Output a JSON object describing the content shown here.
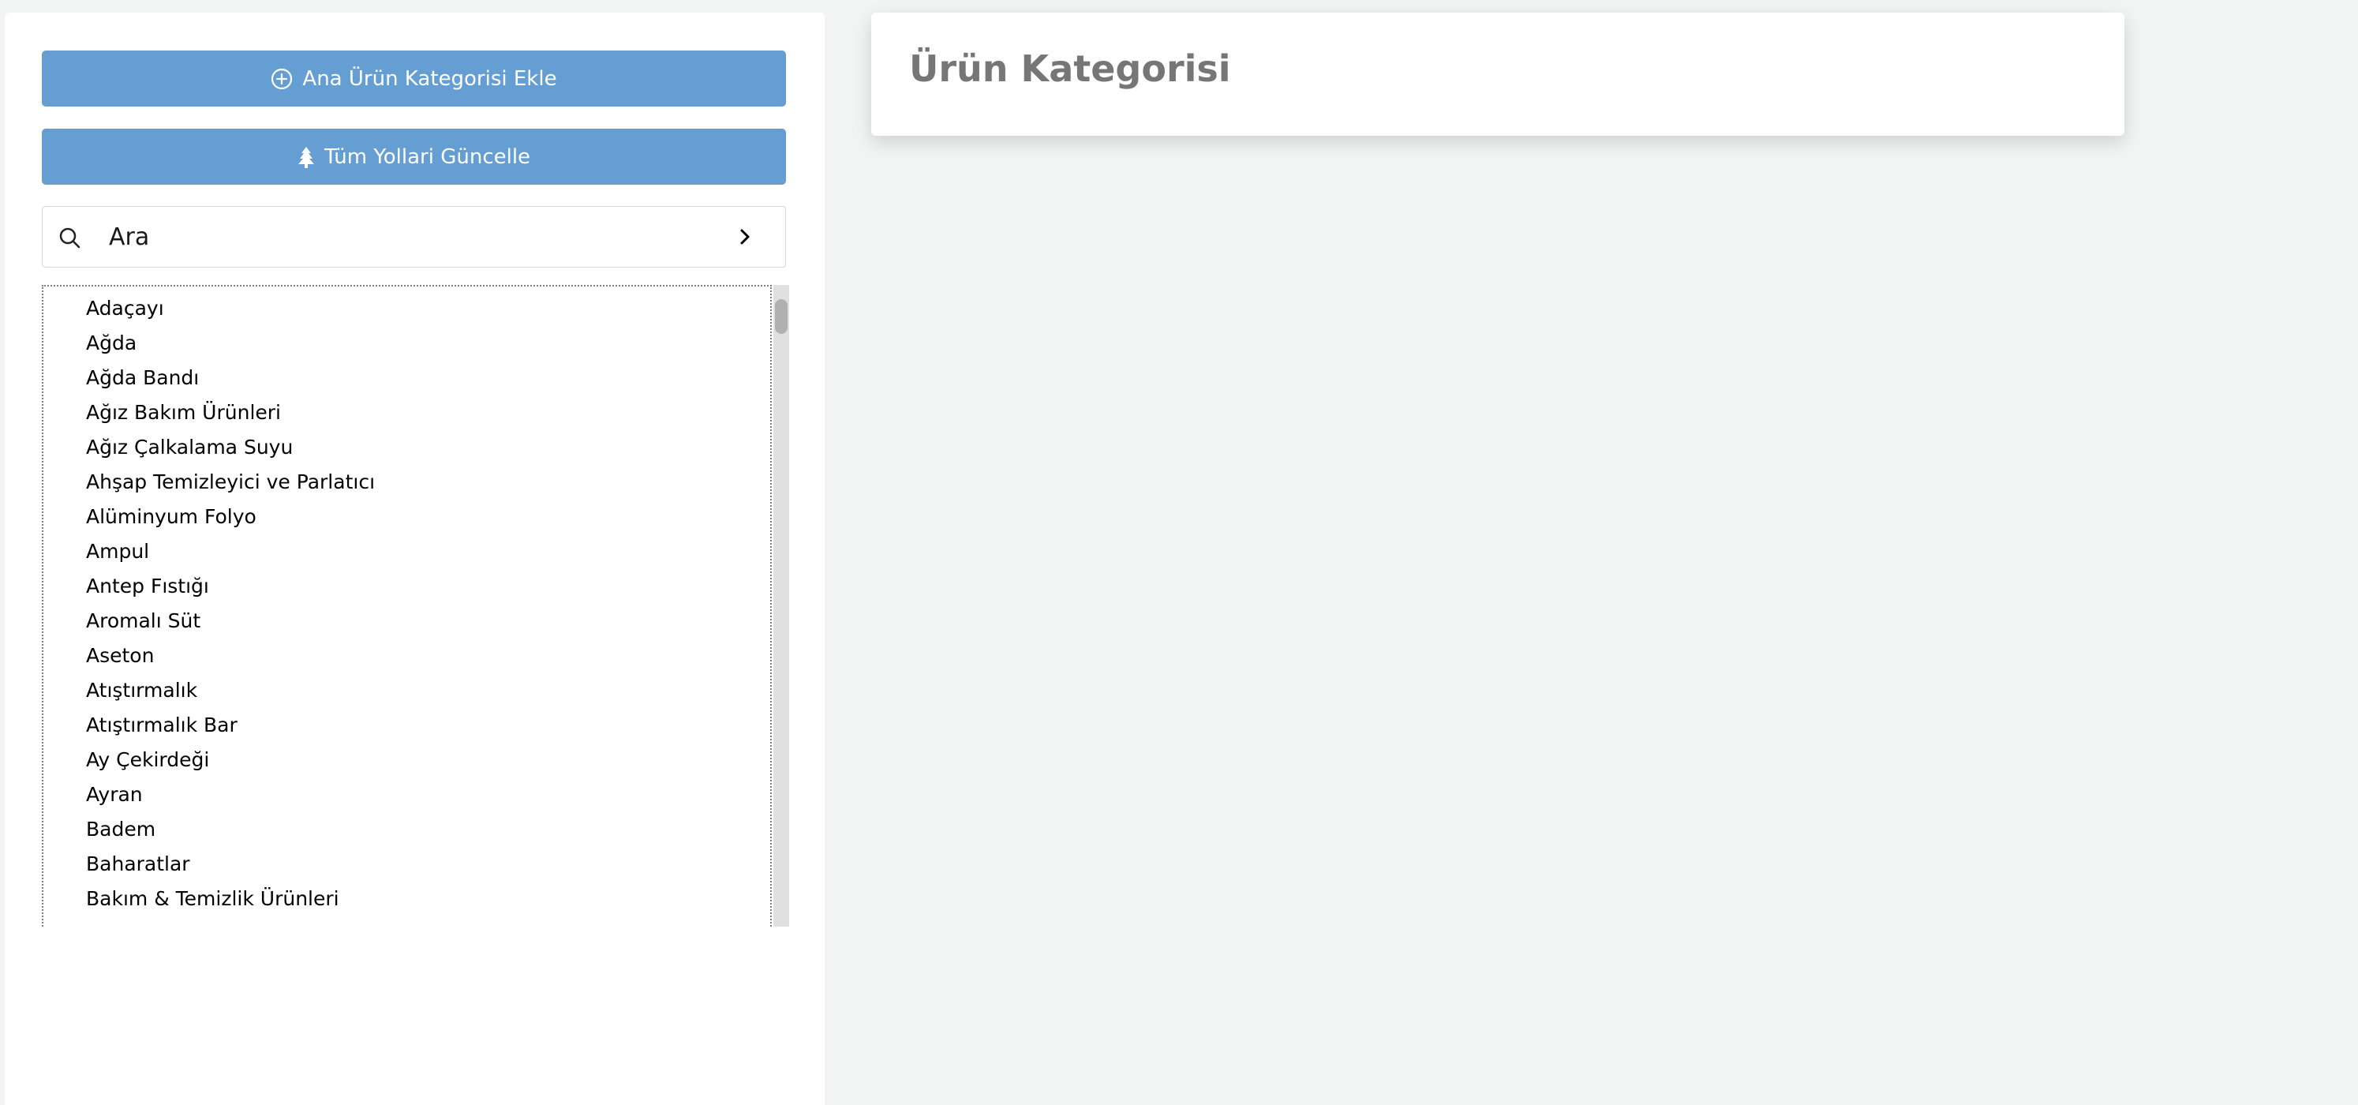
{
  "sidebar": {
    "add_button_label": "Ana Ürün Kategorisi Ekle",
    "update_button_label": "Tüm Yollari Güncelle",
    "search": {
      "placeholder": "Ara"
    },
    "categories": [
      "Adaçayı",
      "Ağda",
      "Ağda Bandı",
      "Ağız Bakım Ürünleri",
      "Ağız Çalkalama Suyu",
      "Ahşap Temizleyici ve Parlatıcı",
      "Alüminyum Folyo",
      "Ampul",
      "Antep Fıstığı",
      "Aromalı Süt",
      "Aseton",
      "Atıştırmalık",
      "Atıştırmalık Bar",
      "Ay Çekirdeği",
      "Ayran",
      "Badem",
      "Baharatlar",
      "Bakım & Temizlik Ürünleri"
    ]
  },
  "main": {
    "title": "Ürün Kategorisi"
  },
  "icons": {
    "add": "plus-circle-icon",
    "update": "tree-icon",
    "search": "search-icon",
    "expand": "chevron-right-icon"
  },
  "colors": {
    "button": "#659ed3",
    "background": "#f2f3f3",
    "title": "#767676"
  }
}
